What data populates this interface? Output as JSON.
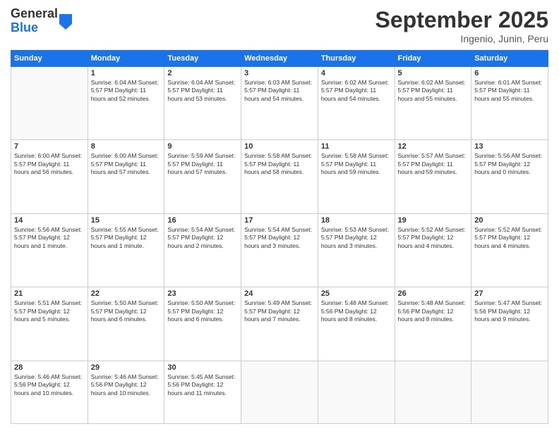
{
  "header": {
    "logo": {
      "line1": "General",
      "line2": "Blue"
    },
    "title": "September 2025",
    "location": "Ingenio, Junin, Peru"
  },
  "calendar": {
    "days_of_week": [
      "Sunday",
      "Monday",
      "Tuesday",
      "Wednesday",
      "Thursday",
      "Friday",
      "Saturday"
    ],
    "weeks": [
      [
        {
          "day": "",
          "info": ""
        },
        {
          "day": "1",
          "info": "Sunrise: 6:04 AM\nSunset: 5:57 PM\nDaylight: 11 hours\nand 52 minutes."
        },
        {
          "day": "2",
          "info": "Sunrise: 6:04 AM\nSunset: 5:57 PM\nDaylight: 11 hours\nand 53 minutes."
        },
        {
          "day": "3",
          "info": "Sunrise: 6:03 AM\nSunset: 5:57 PM\nDaylight: 11 hours\nand 54 minutes."
        },
        {
          "day": "4",
          "info": "Sunrise: 6:02 AM\nSunset: 5:57 PM\nDaylight: 11 hours\nand 54 minutes."
        },
        {
          "day": "5",
          "info": "Sunrise: 6:02 AM\nSunset: 5:57 PM\nDaylight: 11 hours\nand 55 minutes."
        },
        {
          "day": "6",
          "info": "Sunrise: 6:01 AM\nSunset: 5:57 PM\nDaylight: 11 hours\nand 55 minutes."
        }
      ],
      [
        {
          "day": "7",
          "info": "Sunrise: 6:00 AM\nSunset: 5:57 PM\nDaylight: 11 hours\nand 56 minutes."
        },
        {
          "day": "8",
          "info": "Sunrise: 6:00 AM\nSunset: 5:57 PM\nDaylight: 11 hours\nand 57 minutes."
        },
        {
          "day": "9",
          "info": "Sunrise: 5:59 AM\nSunset: 5:57 PM\nDaylight: 11 hours\nand 57 minutes."
        },
        {
          "day": "10",
          "info": "Sunrise: 5:58 AM\nSunset: 5:57 PM\nDaylight: 11 hours\nand 58 minutes."
        },
        {
          "day": "11",
          "info": "Sunrise: 5:58 AM\nSunset: 5:57 PM\nDaylight: 11 hours\nand 59 minutes."
        },
        {
          "day": "12",
          "info": "Sunrise: 5:57 AM\nSunset: 5:57 PM\nDaylight: 11 hours\nand 59 minutes."
        },
        {
          "day": "13",
          "info": "Sunrise: 5:56 AM\nSunset: 5:57 PM\nDaylight: 12 hours\nand 0 minutes."
        }
      ],
      [
        {
          "day": "14",
          "info": "Sunrise: 5:56 AM\nSunset: 5:57 PM\nDaylight: 12 hours\nand 1 minute."
        },
        {
          "day": "15",
          "info": "Sunrise: 5:55 AM\nSunset: 5:57 PM\nDaylight: 12 hours\nand 1 minute."
        },
        {
          "day": "16",
          "info": "Sunrise: 5:54 AM\nSunset: 5:57 PM\nDaylight: 12 hours\nand 2 minutes."
        },
        {
          "day": "17",
          "info": "Sunrise: 5:54 AM\nSunset: 5:57 PM\nDaylight: 12 hours\nand 3 minutes."
        },
        {
          "day": "18",
          "info": "Sunrise: 5:53 AM\nSunset: 5:57 PM\nDaylight: 12 hours\nand 3 minutes."
        },
        {
          "day": "19",
          "info": "Sunrise: 5:52 AM\nSunset: 5:57 PM\nDaylight: 12 hours\nand 4 minutes."
        },
        {
          "day": "20",
          "info": "Sunrise: 5:52 AM\nSunset: 5:57 PM\nDaylight: 12 hours\nand 4 minutes."
        }
      ],
      [
        {
          "day": "21",
          "info": "Sunrise: 5:51 AM\nSunset: 5:57 PM\nDaylight: 12 hours\nand 5 minutes."
        },
        {
          "day": "22",
          "info": "Sunrise: 5:50 AM\nSunset: 5:57 PM\nDaylight: 12 hours\nand 6 minutes."
        },
        {
          "day": "23",
          "info": "Sunrise: 5:50 AM\nSunset: 5:57 PM\nDaylight: 12 hours\nand 6 minutes."
        },
        {
          "day": "24",
          "info": "Sunrise: 5:49 AM\nSunset: 5:57 PM\nDaylight: 12 hours\nand 7 minutes."
        },
        {
          "day": "25",
          "info": "Sunrise: 5:48 AM\nSunset: 5:56 PM\nDaylight: 12 hours\nand 8 minutes."
        },
        {
          "day": "26",
          "info": "Sunrise: 5:48 AM\nSunset: 5:56 PM\nDaylight: 12 hours\nand 8 minutes."
        },
        {
          "day": "27",
          "info": "Sunrise: 5:47 AM\nSunset: 5:56 PM\nDaylight: 12 hours\nand 9 minutes."
        }
      ],
      [
        {
          "day": "28",
          "info": "Sunrise: 5:46 AM\nSunset: 5:56 PM\nDaylight: 12 hours\nand 10 minutes."
        },
        {
          "day": "29",
          "info": "Sunrise: 5:46 AM\nSunset: 5:56 PM\nDaylight: 12 hours\nand 10 minutes."
        },
        {
          "day": "30",
          "info": "Sunrise: 5:45 AM\nSunset: 5:56 PM\nDaylight: 12 hours\nand 11 minutes."
        },
        {
          "day": "",
          "info": ""
        },
        {
          "day": "",
          "info": ""
        },
        {
          "day": "",
          "info": ""
        },
        {
          "day": "",
          "info": ""
        }
      ]
    ]
  }
}
